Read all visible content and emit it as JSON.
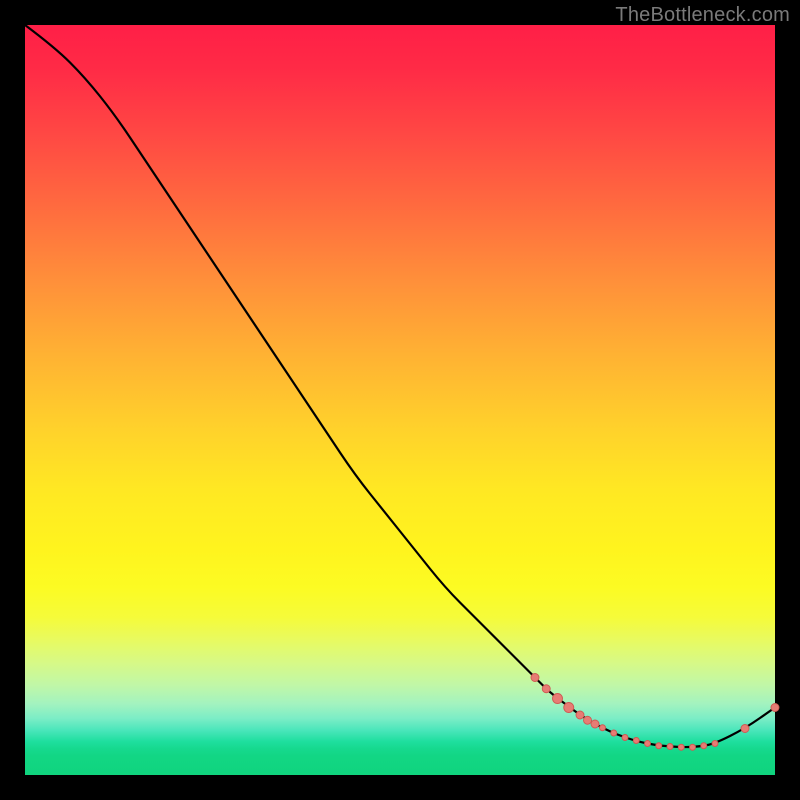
{
  "attribution": "TheBottleneck.com",
  "colors": {
    "curve": "#000000",
    "marker_fill": "#e77c74",
    "marker_stroke": "#cf5a53",
    "background": "#000000"
  },
  "chart_data": {
    "type": "line",
    "title": "",
    "xlabel": "",
    "ylabel": "",
    "xlim": [
      0,
      100
    ],
    "ylim": [
      0,
      100
    ],
    "grid": false,
    "legend": false,
    "series": [
      {
        "name": "bottleneck-curve",
        "x": [
          0,
          4,
          8,
          12,
          16,
          20,
          24,
          28,
          32,
          36,
          40,
          44,
          48,
          52,
          56,
          60,
          64,
          68,
          70,
          72,
          74,
          76,
          78,
          80,
          82,
          84,
          86,
          88,
          90,
          92,
          96,
          100
        ],
        "y": [
          100,
          97,
          93,
          88,
          82,
          76,
          70,
          64,
          58,
          52,
          46,
          40,
          35,
          30,
          25,
          21,
          17,
          13,
          11,
          9.5,
          8,
          6.8,
          5.8,
          5,
          4.4,
          4,
          3.8,
          3.7,
          3.8,
          4.2,
          6.2,
          9
        ]
      }
    ],
    "markers": [
      {
        "x": 68.0,
        "y": 13.0,
        "r": 4
      },
      {
        "x": 69.5,
        "y": 11.5,
        "r": 4
      },
      {
        "x": 71.0,
        "y": 10.2,
        "r": 5
      },
      {
        "x": 72.5,
        "y": 9.0,
        "r": 5
      },
      {
        "x": 74.0,
        "y": 8.0,
        "r": 4
      },
      {
        "x": 75.0,
        "y": 7.3,
        "r": 4
      },
      {
        "x": 76.0,
        "y": 6.8,
        "r": 4
      },
      {
        "x": 77.0,
        "y": 6.3,
        "r": 3
      },
      {
        "x": 78.5,
        "y": 5.6,
        "r": 3
      },
      {
        "x": 80.0,
        "y": 5.0,
        "r": 3
      },
      {
        "x": 81.5,
        "y": 4.6,
        "r": 3
      },
      {
        "x": 83.0,
        "y": 4.2,
        "r": 3
      },
      {
        "x": 84.5,
        "y": 3.9,
        "r": 3
      },
      {
        "x": 86.0,
        "y": 3.8,
        "r": 3
      },
      {
        "x": 87.5,
        "y": 3.7,
        "r": 3
      },
      {
        "x": 89.0,
        "y": 3.7,
        "r": 3
      },
      {
        "x": 90.5,
        "y": 3.9,
        "r": 3
      },
      {
        "x": 92.0,
        "y": 4.2,
        "r": 3
      },
      {
        "x": 96.0,
        "y": 6.2,
        "r": 4
      },
      {
        "x": 100.0,
        "y": 9.0,
        "r": 4
      }
    ]
  }
}
